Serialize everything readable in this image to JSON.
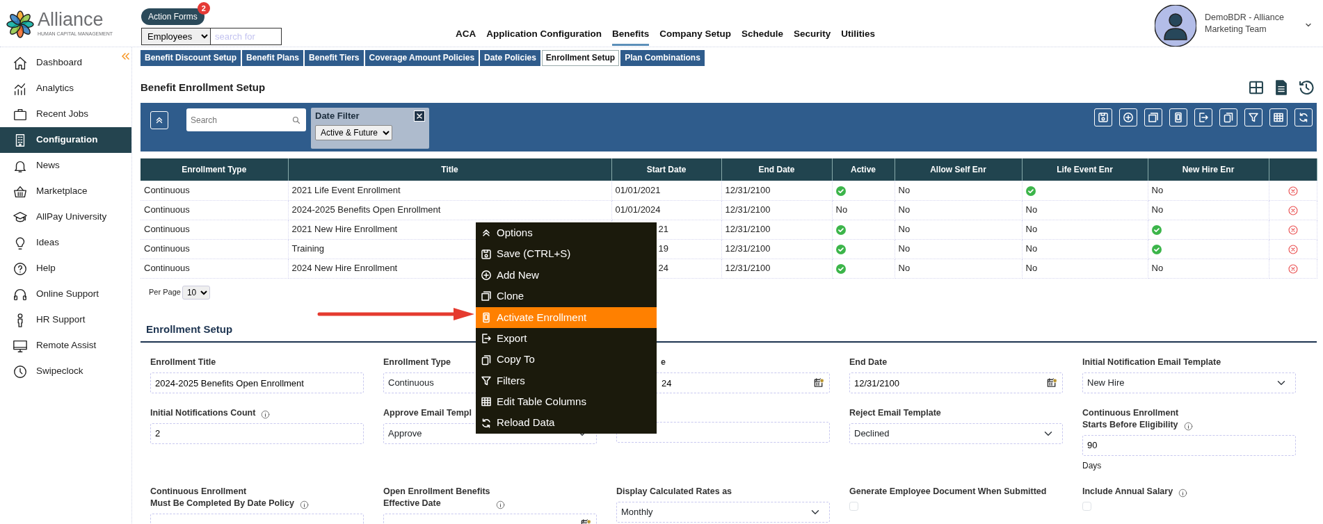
{
  "logo": {
    "name": "Alliance",
    "tagline": "HUMAN CAPITAL MANAGEMENT"
  },
  "action_forms": {
    "label": "Action Forms",
    "badge": "2"
  },
  "search": {
    "scope": "Employees",
    "placeholder": "search for"
  },
  "top_nav": [
    {
      "label": "ACA",
      "selected": false
    },
    {
      "label": "Application Configuration",
      "selected": false
    },
    {
      "label": "Benefits",
      "selected": true
    },
    {
      "label": "Company Setup",
      "selected": false
    },
    {
      "label": "Schedule",
      "selected": false
    },
    {
      "label": "Security",
      "selected": false
    },
    {
      "label": "Utilities",
      "selected": false
    }
  ],
  "user": {
    "name": "DemoBDR - Alliance Marketing Team"
  },
  "sidebar": {
    "items": [
      {
        "label": "Dashboard",
        "selected": false
      },
      {
        "label": "Analytics",
        "selected": false
      },
      {
        "label": "Recent Jobs",
        "selected": false
      },
      {
        "label": "Configuration",
        "selected": true
      },
      {
        "label": "News",
        "selected": false
      },
      {
        "label": "Marketplace",
        "selected": false
      },
      {
        "label": "AllPay University",
        "selected": false
      },
      {
        "label": "Ideas",
        "selected": false
      },
      {
        "label": "Help",
        "selected": false
      },
      {
        "label": "Online Support",
        "selected": false
      },
      {
        "label": "HR Support",
        "selected": false
      },
      {
        "label": "Remote Assist",
        "selected": false
      },
      {
        "label": "Swipeclock",
        "selected": false
      }
    ]
  },
  "subtabs": [
    {
      "label": "Benefit Discount Setup",
      "selected": false
    },
    {
      "label": "Benefit Plans",
      "selected": false
    },
    {
      "label": "Benefit Tiers",
      "selected": false
    },
    {
      "label": "Coverage Amount Policies",
      "selected": false
    },
    {
      "label": "Date Policies",
      "selected": false
    },
    {
      "label": "Enrollment Setup",
      "selected": true
    },
    {
      "label": "Plan Combinations",
      "selected": false
    }
  ],
  "page_title": "Benefit Enrollment Setup",
  "toolbar": {
    "search_placeholder": "Search",
    "date_filter": {
      "label": "Date Filter",
      "value": "Active & Future"
    }
  },
  "table": {
    "columns": [
      "Enrollment Type",
      "Title",
      "Start Date",
      "End Date",
      "Active",
      "Allow Self Enr",
      "Life Event Enr",
      "New Hire Enr"
    ],
    "rows": [
      {
        "cells": [
          {
            "kind": "text",
            "text": "Continuous"
          },
          {
            "kind": "text",
            "text": "2021 Life Event Enrollment"
          },
          {
            "kind": "text",
            "text": "01/01/2021"
          },
          {
            "kind": "text",
            "text": "12/31/2100"
          },
          {
            "kind": "check"
          },
          {
            "kind": "text",
            "text": "No"
          },
          {
            "kind": "check"
          },
          {
            "kind": "text",
            "text": "No"
          },
          {
            "kind": "delete"
          }
        ]
      },
      {
        "cells": [
          {
            "kind": "text",
            "text": "Continuous"
          },
          {
            "kind": "text",
            "text": "2024-2025 Benefits Open Enrollment"
          },
          {
            "kind": "text",
            "text": "01/01/2024"
          },
          {
            "kind": "text",
            "text": "12/31/2100"
          },
          {
            "kind": "text",
            "text": "No"
          },
          {
            "kind": "text",
            "text": "No"
          },
          {
            "kind": "text",
            "text": "No"
          },
          {
            "kind": "text",
            "text": "No"
          },
          {
            "kind": "delete"
          }
        ]
      },
      {
        "cells": [
          {
            "kind": "text",
            "text": "Continuous"
          },
          {
            "kind": "text",
            "text": "2021 New Hire Enrollment"
          },
          {
            "kind": "text",
            "text": "21",
            "covered": true
          },
          {
            "kind": "text",
            "text": "12/31/2100"
          },
          {
            "kind": "check"
          },
          {
            "kind": "text",
            "text": "No"
          },
          {
            "kind": "text",
            "text": "No"
          },
          {
            "kind": "check"
          },
          {
            "kind": "delete"
          }
        ]
      },
      {
        "cells": [
          {
            "kind": "text",
            "text": "Continuous"
          },
          {
            "kind": "text",
            "text": "Training"
          },
          {
            "kind": "text",
            "text": "19",
            "covered": true
          },
          {
            "kind": "text",
            "text": "12/31/2100"
          },
          {
            "kind": "check"
          },
          {
            "kind": "text",
            "text": "No"
          },
          {
            "kind": "text",
            "text": "No"
          },
          {
            "kind": "check"
          },
          {
            "kind": "delete"
          }
        ]
      },
      {
        "cells": [
          {
            "kind": "text",
            "text": "Continuous"
          },
          {
            "kind": "text",
            "text": "2024 New Hire Enrollment"
          },
          {
            "kind": "text",
            "text": "24",
            "covered": true
          },
          {
            "kind": "text",
            "text": "12/31/2100"
          },
          {
            "kind": "check"
          },
          {
            "kind": "text",
            "text": "No"
          },
          {
            "kind": "text",
            "text": "No"
          },
          {
            "kind": "text",
            "text": "No"
          },
          {
            "kind": "delete"
          }
        ]
      }
    ]
  },
  "per_page": {
    "label": "Per Page",
    "value": "10"
  },
  "context_menu": {
    "items": [
      {
        "label": "Options",
        "selected": false
      },
      {
        "label": "Save (CTRL+S)",
        "selected": false
      },
      {
        "label": "Add New",
        "selected": false
      },
      {
        "label": "Clone",
        "selected": false
      },
      {
        "label": "Activate Enrollment",
        "selected": true
      },
      {
        "label": "Export",
        "selected": false
      },
      {
        "label": "Copy To",
        "selected": false
      },
      {
        "label": "Filters",
        "selected": false
      },
      {
        "label": "Edit Table Columns",
        "selected": false
      },
      {
        "label": "Reload Data",
        "selected": false
      }
    ]
  },
  "form": {
    "title": "Enrollment Setup",
    "fields": [
      {
        "kind": "text",
        "label": "Enrollment Title",
        "value": "2024-2025 Benefits Open Enrollment"
      },
      {
        "kind": "select",
        "label": "Enrollment Type",
        "value": "Continuous"
      },
      {
        "kind": "date",
        "label": "e",
        "value": "24",
        "covered": true
      },
      {
        "kind": "date",
        "label": "End Date",
        "value": "12/31/2100"
      },
      {
        "kind": "select",
        "label": "Initial Notification Email Template",
        "value": "New Hire"
      },
      {
        "kind": "text",
        "label": "Initial Notifications Count",
        "info": true,
        "value": "2"
      },
      {
        "kind": "select",
        "label": "Approve Email Templ",
        "value": "Approve"
      },
      {
        "kind": "text"
      },
      {
        "kind": "select",
        "label": "Reject Email Template",
        "value": "Declined"
      },
      {
        "kind": "text",
        "label_lines": [
          "Continuous Enrollment",
          "Starts Before Eligibility"
        ],
        "info": true,
        "value": "90",
        "hint": "Days"
      },
      {
        "kind": "text",
        "label_lines": [
          "Continuous Enrollment",
          "Must Be Completed By Date Policy"
        ],
        "info": true
      },
      {
        "kind": "date",
        "label_lines": [
          "Open Enrollment Benefits",
          "Effective Date"
        ],
        "info": true
      },
      {
        "kind": "select",
        "label": "Display Calculated Rates as",
        "value": "Monthly"
      },
      {
        "kind": "checkbox",
        "label": "Generate Employee Document When Submitted",
        "checked": false
      },
      {
        "kind": "checkbox",
        "label": "Include Annual Salary",
        "info": true,
        "checked": false
      }
    ]
  }
}
